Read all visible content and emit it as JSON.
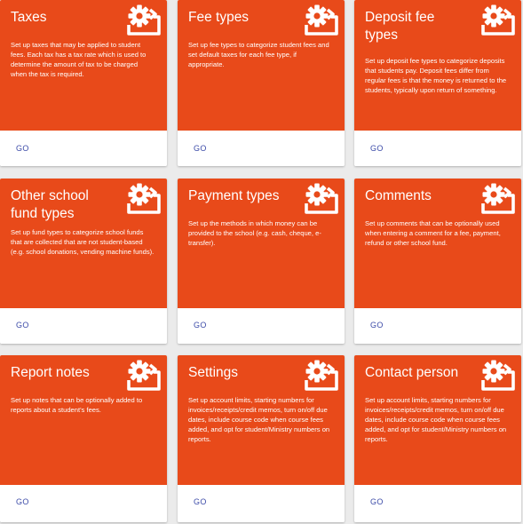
{
  "accent_color": "#e84a1a",
  "link_color": "#3c4ba8",
  "cards": [
    {
      "title": "Taxes",
      "description": "Set up taxes that may be applied to student fees. Each tax has a tax rate which is used to determine the amount of tax to be charged when the tax is required.",
      "icon": "settings-app-icon",
      "action_label": "GO"
    },
    {
      "title": "Fee types",
      "description": "Set up fee types to categorize student fees and set default taxes for each fee type, if appropriate.",
      "icon": "settings-app-icon",
      "action_label": "GO"
    },
    {
      "title": "Deposit fee types",
      "description": "Set up deposit fee types to categorize deposits that students pay. Deposit fees differ from regular fees is that the money is returned to the students, typically upon return of something.",
      "icon": "settings-app-icon",
      "action_label": "GO"
    },
    {
      "title": "Other school fund types",
      "description": "Set up fund types to categorize school funds that are collected that are not student-based (e.g. school donations, vending machine funds).",
      "icon": "settings-app-icon",
      "action_label": "GO"
    },
    {
      "title": "Payment types",
      "description": "Set up the methods in which money can be provided to the school (e.g. cash, cheque, e-transfer).",
      "icon": "settings-app-icon",
      "action_label": "GO"
    },
    {
      "title": "Comments",
      "description": "Set up comments that can be optionally used when entering a comment for a fee, payment, refund or other school fund.",
      "icon": "settings-app-icon",
      "action_label": "GO"
    },
    {
      "title": "Report notes",
      "description": "Set up notes that can be optionally added to reports about a student's fees.",
      "icon": "settings-app-icon",
      "action_label": "GO"
    },
    {
      "title": "Settings",
      "description": "Set up account limits, starting numbers for invoices/receipts/credit memos, turn on/off due dates, include course code when course fees added, and opt for student/Ministry numbers on reports.",
      "icon": "settings-app-icon",
      "action_label": "GO"
    },
    {
      "title": "Contact person",
      "description": "Set up account limits, starting numbers for invoices/receipts/credit memos, turn on/off due dates, include course code when course fees added, and opt for student/Ministry numbers on reports.",
      "icon": "settings-app-icon",
      "action_label": "GO"
    }
  ]
}
